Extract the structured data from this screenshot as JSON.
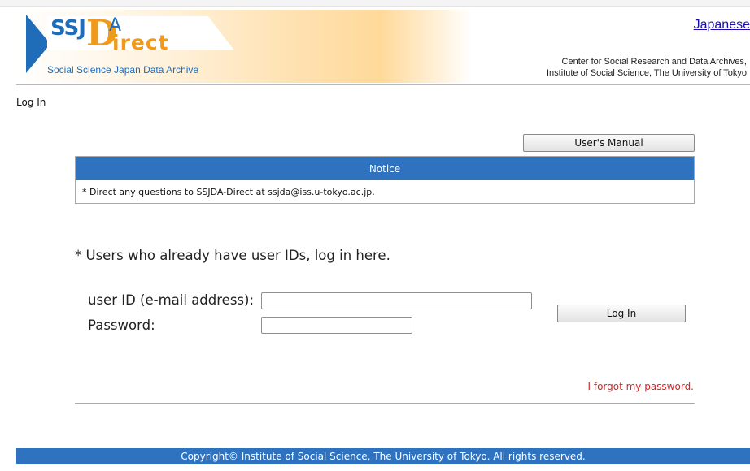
{
  "header": {
    "logo": {
      "ssj": "SSJ",
      "d": "D",
      "a": "A",
      "irect": "irect",
      "subtitle": "Social Science Japan Data Archive"
    },
    "language_link": "Japanese",
    "institution_line1": "Center for Social Research and Data Archives,",
    "institution_line2": "Institute of Social Science, The University of Tokyo"
  },
  "breadcrumb": "Log In",
  "manual_button": "User's Manual",
  "notice": {
    "title": "Notice",
    "text": "* Direct any questions to SSJDA-Direct at ssjda@iss.u-tokyo.ac.jp."
  },
  "login": {
    "intro": "* Users who already have user IDs, log in here.",
    "user_id_label": "user ID (e-mail address):",
    "user_id_value": "",
    "password_label": "Password:",
    "password_value": "",
    "button": "Log In",
    "forgot_link": "I forgot my password."
  },
  "footer": "Copyright© Institute of Social Science, The University of Tokyo. All rights reserved.",
  "colors": {
    "accent_blue": "#2f72c0",
    "logo_orange": "#f09a1c",
    "link_red": "#e02020"
  }
}
